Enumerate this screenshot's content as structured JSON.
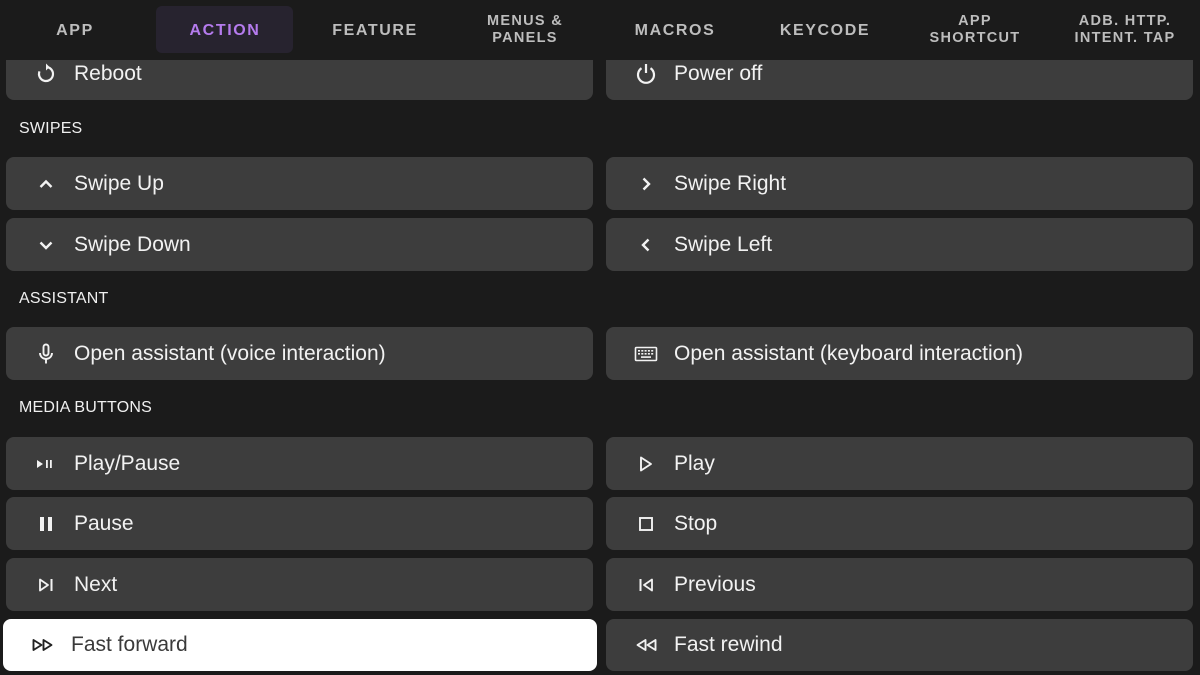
{
  "tabs": [
    {
      "label": "APP",
      "active": false
    },
    {
      "label": "ACTION",
      "active": true
    },
    {
      "label": "FEATURE",
      "active": false
    },
    {
      "label": "MENUS &\nPANELS",
      "active": false
    },
    {
      "label": "MACROS",
      "active": false
    },
    {
      "label": "KEYCODE",
      "active": false
    },
    {
      "label": "APP\nSHORTCUT",
      "active": false
    },
    {
      "label": "ADB. HTTP.\nINTENT. TAP",
      "active": false
    }
  ],
  "colors": {
    "accent": "#b57bee",
    "active_tab_bg": "#27232f",
    "background": "#1b1b1b",
    "card": "#3d3d3d",
    "focused_card": "#ffffff"
  },
  "power": {
    "reboot": {
      "label": "Reboot",
      "icon": "restart-icon"
    },
    "power_off": {
      "label": "Power off",
      "icon": "power-icon"
    }
  },
  "sections": {
    "swipes": {
      "title": "SWIPES",
      "swipe_up": {
        "label": "Swipe Up",
        "icon": "chevron-up-icon"
      },
      "swipe_right": {
        "label": "Swipe Right",
        "icon": "chevron-right-icon"
      },
      "swipe_down": {
        "label": "Swipe Down",
        "icon": "chevron-down-icon"
      },
      "swipe_left": {
        "label": "Swipe Left",
        "icon": "chevron-left-icon"
      }
    },
    "assistant": {
      "title": "ASSISTANT",
      "voice": {
        "label": "Open assistant (voice interaction)",
        "icon": "microphone-icon"
      },
      "keyboard": {
        "label": "Open assistant (keyboard interaction)",
        "icon": "keyboard-icon"
      }
    },
    "media": {
      "title": "MEDIA BUTTONS",
      "play_pause": {
        "label": "Play/Pause",
        "icon": "play-pause-icon"
      },
      "play": {
        "label": "Play",
        "icon": "play-icon"
      },
      "pause": {
        "label": "Pause",
        "icon": "pause-icon"
      },
      "stop": {
        "label": "Stop",
        "icon": "stop-icon"
      },
      "next": {
        "label": "Next",
        "icon": "skip-next-icon"
      },
      "previous": {
        "label": "Previous",
        "icon": "skip-previous-icon"
      },
      "fast_forward": {
        "label": "Fast forward",
        "icon": "fast-forward-icon",
        "focused": true
      },
      "fast_rewind": {
        "label": "Fast rewind",
        "icon": "fast-rewind-icon"
      }
    }
  }
}
